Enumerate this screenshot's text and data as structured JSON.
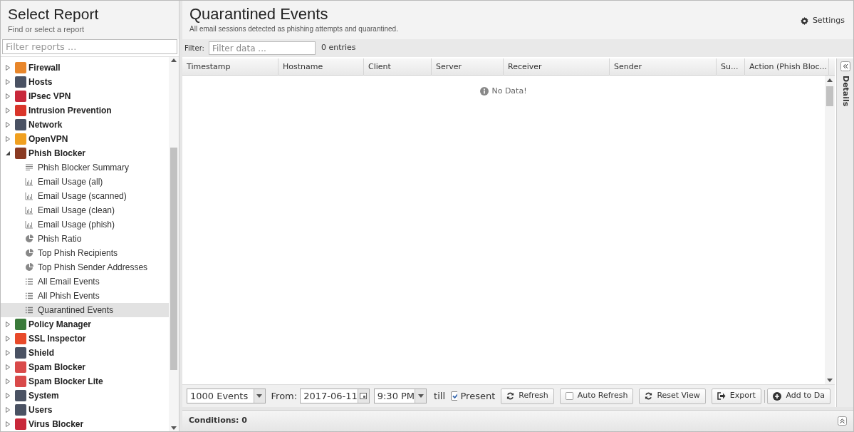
{
  "sidebar": {
    "title": "Select Report",
    "subtitle": "Find or select a report",
    "filter_placeholder": "Filter reports ...",
    "tree": [
      {
        "label": "Firewall",
        "color": "#e8862a",
        "expanded": false
      },
      {
        "label": "Hosts",
        "color": "#4a5263",
        "expanded": false
      },
      {
        "label": "IPsec VPN",
        "color": "#c8283a",
        "expanded": false
      },
      {
        "label": "Intrusion Prevention",
        "color": "#d9352a",
        "expanded": false
      },
      {
        "label": "Network",
        "color": "#4a5263",
        "expanded": false
      },
      {
        "label": "OpenVPN",
        "color": "#f0a020",
        "expanded": false
      },
      {
        "label": "Phish Blocker",
        "color": "#8a3a22",
        "expanded": true,
        "children": [
          {
            "label": "Phish Blocker Summary",
            "kind": "summary",
            "selected": false
          },
          {
            "label": "Email Usage (all)",
            "kind": "bar",
            "selected": false
          },
          {
            "label": "Email Usage (scanned)",
            "kind": "bar",
            "selected": false
          },
          {
            "label": "Email Usage (clean)",
            "kind": "bar",
            "selected": false
          },
          {
            "label": "Email Usage (phish)",
            "kind": "bar",
            "selected": false
          },
          {
            "label": "Phish Ratio",
            "kind": "pie",
            "selected": false
          },
          {
            "label": "Top Phish Recipients",
            "kind": "pie",
            "selected": false
          },
          {
            "label": "Top Phish Sender Addresses",
            "kind": "pie",
            "selected": false
          },
          {
            "label": "All Email Events",
            "kind": "list",
            "selected": false
          },
          {
            "label": "All Phish Events",
            "kind": "list",
            "selected": false
          },
          {
            "label": "Quarantined Events",
            "kind": "list",
            "selected": true
          }
        ]
      },
      {
        "label": "Policy Manager",
        "color": "#3a7a3a",
        "expanded": false
      },
      {
        "label": "SSL Inspector",
        "color": "#e84a2a",
        "expanded": false
      },
      {
        "label": "Shield",
        "color": "#4a5263",
        "expanded": false
      },
      {
        "label": "Spam Blocker",
        "color": "#d94a4a",
        "expanded": false
      },
      {
        "label": "Spam Blocker Lite",
        "color": "#d94a4a",
        "expanded": false
      },
      {
        "label": "System",
        "color": "#4a5263",
        "expanded": false
      },
      {
        "label": "Users",
        "color": "#4a5263",
        "expanded": false
      },
      {
        "label": "Virus Blocker",
        "color": "#c8283a",
        "expanded": false
      }
    ]
  },
  "report": {
    "title": "Quarantined Events",
    "subtitle": "All email sessions detected as phishing attempts and quarantined.",
    "settings": "Settings",
    "filter_label": "Filter:",
    "filter_placeholder": "Filter data ...",
    "entries": "0 entries",
    "columns": [
      "Timestamp",
      "Hostname",
      "Client",
      "Server",
      "Receiver",
      "Sender",
      "Su...",
      "Action (Phish Bloc..."
    ],
    "empty": "No Data!",
    "toolbar": {
      "limit": "1000 Events",
      "from_label": "From:",
      "date": "2017-06-11",
      "time": "9:30 PM",
      "till": "till",
      "present": "Present",
      "present_checked": true,
      "auto_refresh_checked": false,
      "buttons": [
        {
          "label": "Refresh",
          "kind": "refresh"
        },
        {
          "label": "Auto Refresh",
          "kind": "checkbox"
        },
        {
          "label": "Reset View",
          "kind": "refresh"
        },
        {
          "label": "Export",
          "kind": "export"
        },
        {
          "label": "Add to Da",
          "kind": "add"
        }
      ]
    },
    "conditions": "Conditions: 0"
  },
  "details_panel": {
    "label": "Details"
  }
}
